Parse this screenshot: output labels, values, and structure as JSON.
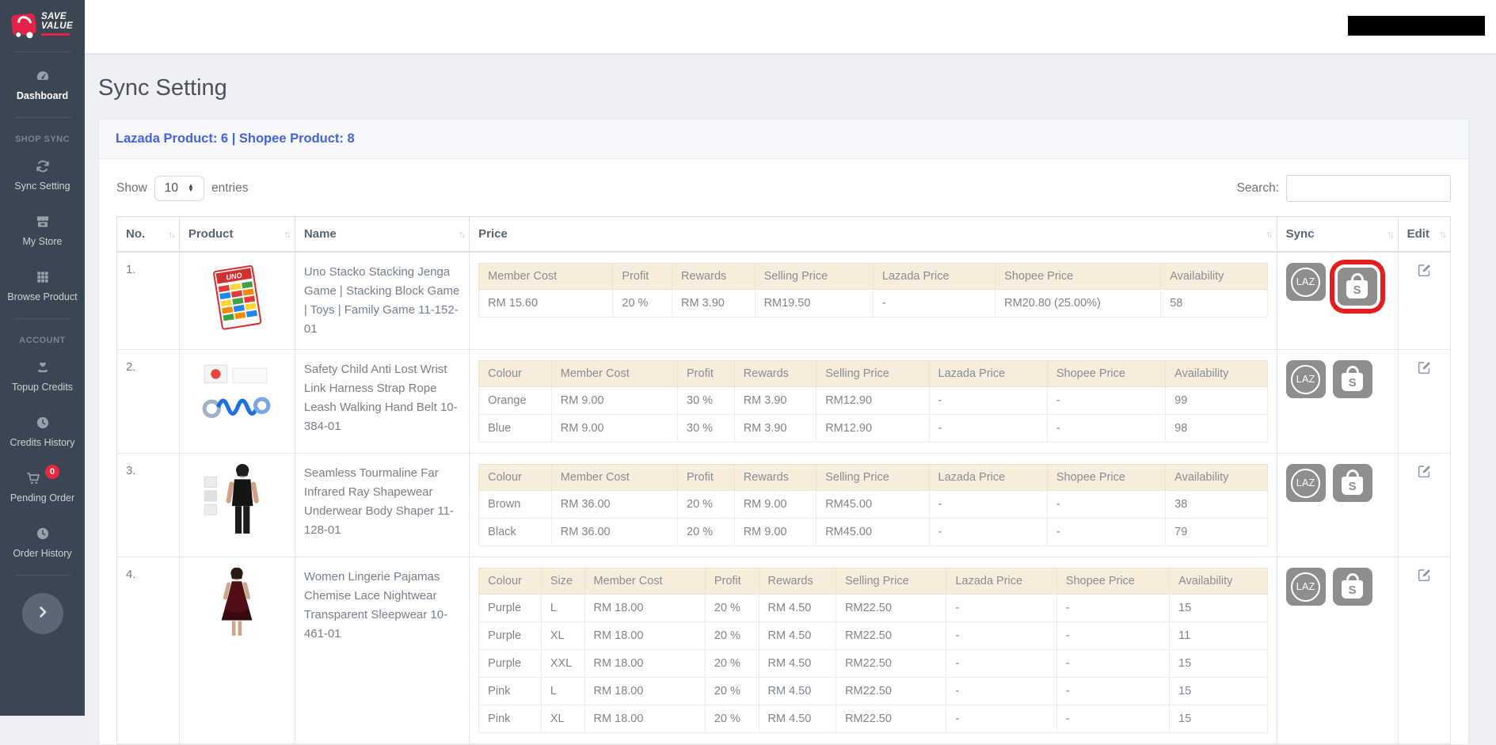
{
  "colors": {
    "sidebar_bg": "#3a4651",
    "brand_red": "#e4234a",
    "accent_blue": "#4463e2",
    "badge_red": "#e8273f",
    "subtable_header_bg": "#f8ecdc",
    "sync_button_gray": "#8e8e8e",
    "highlight_red": "#e51c1c"
  },
  "sidebar": {
    "logo": {
      "line1": "SAVE",
      "line2": "VALUE"
    },
    "items": [
      {
        "type": "divider"
      },
      {
        "type": "link",
        "label": "Dashboard",
        "icon": "dashboard",
        "active": true
      },
      {
        "type": "divider"
      },
      {
        "type": "section",
        "label": "SHOP SYNC"
      },
      {
        "type": "link",
        "label": "Sync Setting",
        "icon": "sync"
      },
      {
        "type": "link",
        "label": "My Store",
        "icon": "store"
      },
      {
        "type": "link",
        "label": "Browse Product",
        "icon": "grid"
      },
      {
        "type": "divider"
      },
      {
        "type": "section",
        "label": "ACCOUNT"
      },
      {
        "type": "link",
        "label": "Topup Credits",
        "icon": "hand-heart"
      },
      {
        "type": "link",
        "label": "Credits History",
        "icon": "clock"
      },
      {
        "type": "link",
        "label": "Pending Order",
        "icon": "cart",
        "badge": "0"
      },
      {
        "type": "link",
        "label": "Order History",
        "icon": "clock"
      },
      {
        "type": "divider"
      }
    ]
  },
  "page": {
    "title": "Sync Setting",
    "card_header": "Lazada Product: 6 | Shopee Product: 8"
  },
  "controls": {
    "show_label": "Show",
    "page_size": "10",
    "entries_label": "entries",
    "search_label": "Search:",
    "search_value": ""
  },
  "table": {
    "headers": [
      "No.",
      "Product",
      "Name",
      "Price",
      "Sync",
      "Edit"
    ],
    "rows": [
      {
        "no": "1.",
        "image": "uno-stacko",
        "name": "Uno Stacko Stacking Jenga Game | Stacking Block Game | Toys | Family Game 11-152-01",
        "price_columns": [
          "Member Cost",
          "Profit",
          "Rewards",
          "Selling Price",
          "Lazada Price",
          "Shopee Price",
          "Availability"
        ],
        "price_rows": [
          [
            "RM 15.60",
            "20 %",
            "RM 3.90",
            "RM19.50",
            "-",
            "RM20.80 (25.00%)",
            "58"
          ]
        ],
        "sync": {
          "lazada_label": "LAZ",
          "shopee_letter": "S",
          "shopee_highlighted": true
        }
      },
      {
        "no": "2.",
        "image": "wrist-strap",
        "name": "Safety Child Anti Lost Wrist Link Harness Strap Rope Leash Walking Hand Belt 10-384-01",
        "price_columns": [
          "Colour",
          "Member Cost",
          "Profit",
          "Rewards",
          "Selling Price",
          "Lazada Price",
          "Shopee Price",
          "Availability"
        ],
        "price_rows": [
          [
            "Orange",
            "RM 9.00",
            "30 %",
            "RM 3.90",
            "RM12.90",
            "-",
            "-",
            "99"
          ],
          [
            "Blue",
            "RM 9.00",
            "30 %",
            "RM 3.90",
            "RM12.90",
            "-",
            "-",
            "98"
          ]
        ],
        "sync": {
          "lazada_label": "LAZ",
          "shopee_letter": "S",
          "shopee_highlighted": false
        }
      },
      {
        "no": "3.",
        "image": "shapewear",
        "name": "Seamless Tourmaline Far Infrared Ray Shapewear Underwear Body Shaper 11-128-01",
        "price_columns": [
          "Colour",
          "Member Cost",
          "Profit",
          "Rewards",
          "Selling Price",
          "Lazada Price",
          "Shopee Price",
          "Availability"
        ],
        "price_rows": [
          [
            "Brown",
            "RM 36.00",
            "20 %",
            "RM 9.00",
            "RM45.00",
            "-",
            "-",
            "38"
          ],
          [
            "Black",
            "RM 36.00",
            "20 %",
            "RM 9.00",
            "RM45.00",
            "-",
            "-",
            "79"
          ]
        ],
        "sync": {
          "lazada_label": "LAZ",
          "shopee_letter": "S",
          "shopee_highlighted": false
        }
      },
      {
        "no": "4.",
        "image": "nightwear",
        "name": "Women Lingerie Pajamas Chemise Lace Nightwear Transparent Sleepwear 10-461-01",
        "price_columns": [
          "Colour",
          "Size",
          "Member Cost",
          "Profit",
          "Rewards",
          "Selling Price",
          "Lazada Price",
          "Shopee Price",
          "Availability"
        ],
        "price_rows": [
          [
            "Purple",
            "L",
            "RM 18.00",
            "20 %",
            "RM 4.50",
            "RM22.50",
            "-",
            "-",
            "15"
          ],
          [
            "Purple",
            "XL",
            "RM 18.00",
            "20 %",
            "RM 4.50",
            "RM22.50",
            "-",
            "-",
            "11"
          ],
          [
            "Purple",
            "XXL",
            "RM 18.00",
            "20 %",
            "RM 4.50",
            "RM22.50",
            "-",
            "-",
            "15"
          ],
          [
            "Pink",
            "L",
            "RM 18.00",
            "20 %",
            "RM 4.50",
            "RM22.50",
            "-",
            "-",
            "15"
          ],
          [
            "Pink",
            "XL",
            "RM 18.00",
            "20 %",
            "RM 4.50",
            "RM22.50",
            "-",
            "-",
            "15"
          ]
        ],
        "sync": {
          "lazada_label": "LAZ",
          "shopee_letter": "S",
          "shopee_highlighted": false
        }
      }
    ]
  }
}
